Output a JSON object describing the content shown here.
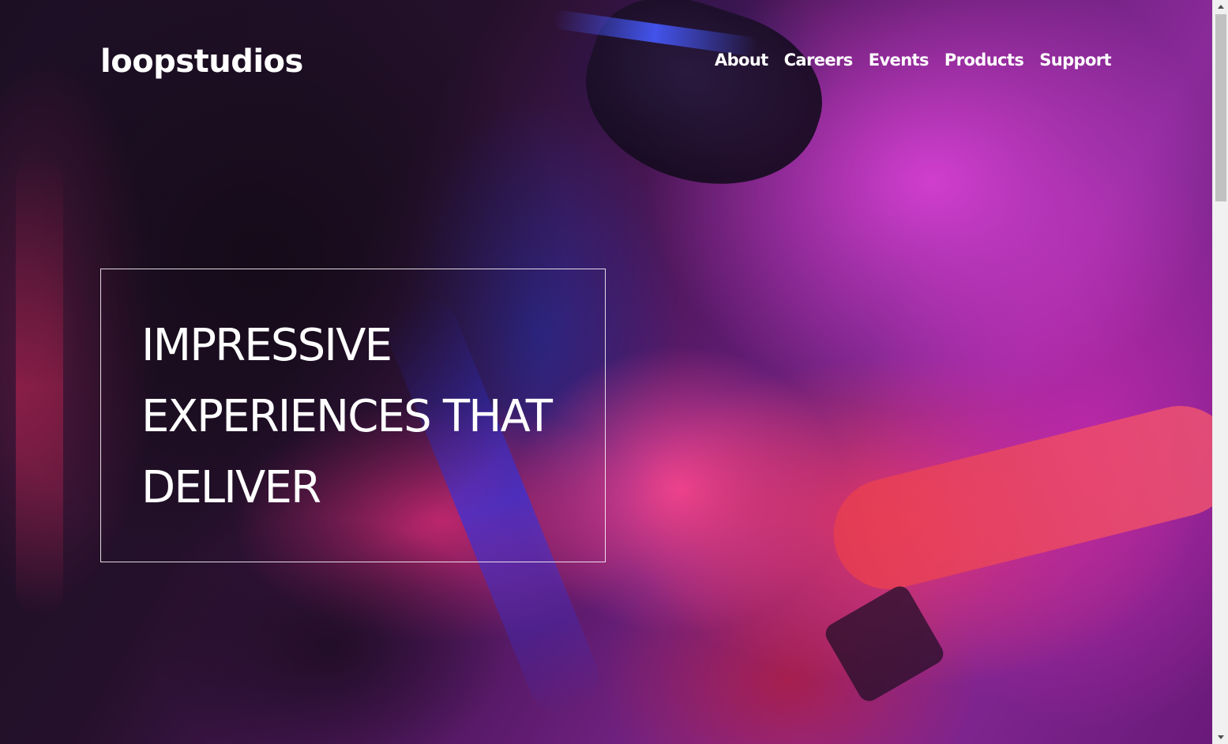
{
  "header": {
    "logo_text": "loopstudios",
    "nav": [
      {
        "label": "About"
      },
      {
        "label": "Careers"
      },
      {
        "label": "Events"
      },
      {
        "label": "Products"
      },
      {
        "label": "Support"
      }
    ]
  },
  "hero": {
    "title_lines": [
      "IMPRESSIVE",
      "EXPERIENCES THAT",
      "DELIVER"
    ],
    "background_icon": "neon-vr-photo"
  },
  "colors": {
    "text": "#ffffff",
    "background_dark": "#120a14",
    "accent_magenta": "#d640d2",
    "accent_red": "#ec3860",
    "accent_blue": "#4656ff",
    "scrollbar_track": "#f1f1f1",
    "scrollbar_thumb": "#c1c1c1"
  }
}
